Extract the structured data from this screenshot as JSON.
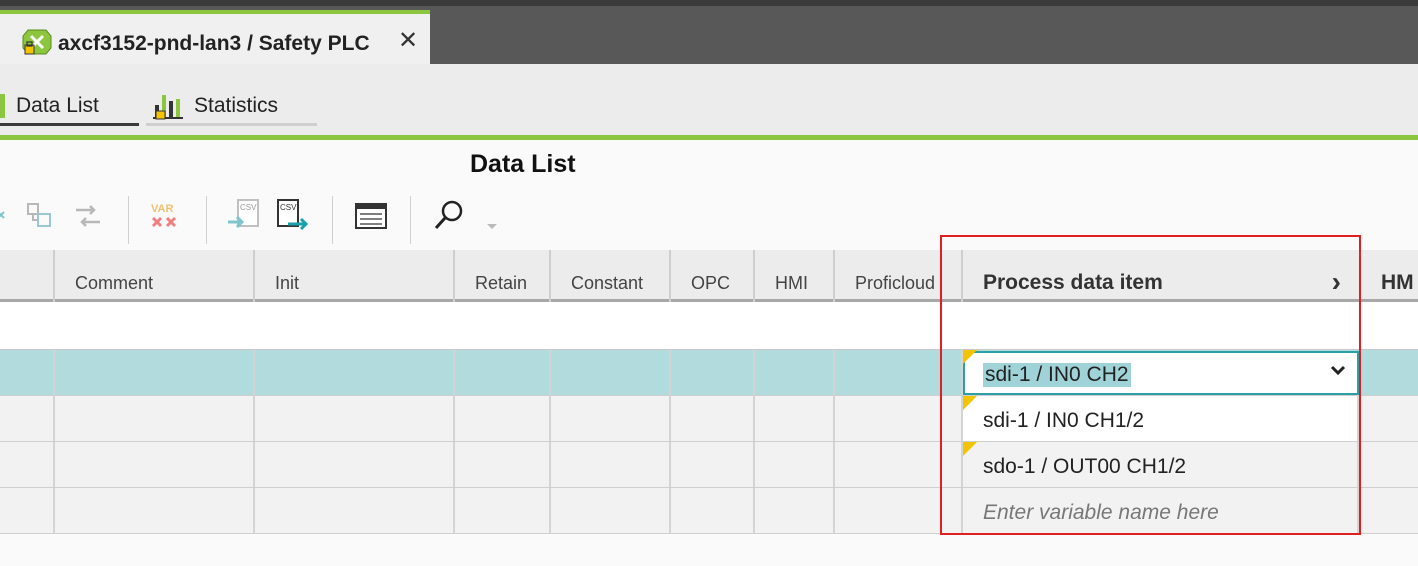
{
  "document_tab": {
    "title": "axcf3152-pnd-lan3 / Safety PLC",
    "close_glyph": "✕"
  },
  "subtabs": [
    {
      "label": "Data List"
    },
    {
      "label": "Statistics"
    }
  ],
  "panel": {
    "title": "Data List"
  },
  "columns": {
    "comment": "Comment",
    "init": "Init",
    "retain": "Retain",
    "constant": "Constant",
    "opc": "OPC",
    "hmi": "HMI",
    "proficloud": "Proficloud",
    "process_data_item": "Process data item",
    "next_column_partial": "HM",
    "header_expand_glyph": "›"
  },
  "rows": [
    {
      "process_data_item": "sdi-1 / IN0 CH2",
      "selected": true
    },
    {
      "process_data_item": "sdi-1 / IN0 CH1/2"
    },
    {
      "process_data_item": "sdo-1 / OUT00 CH1/2"
    },
    {
      "process_data_item": "Enter variable name here",
      "placeholder": true
    }
  ],
  "colors": {
    "accent_green": "#8cc63f",
    "selection_row": "#b2dbdd",
    "highlight_border": "#e02020",
    "flag_yellow": "#f5c400"
  }
}
